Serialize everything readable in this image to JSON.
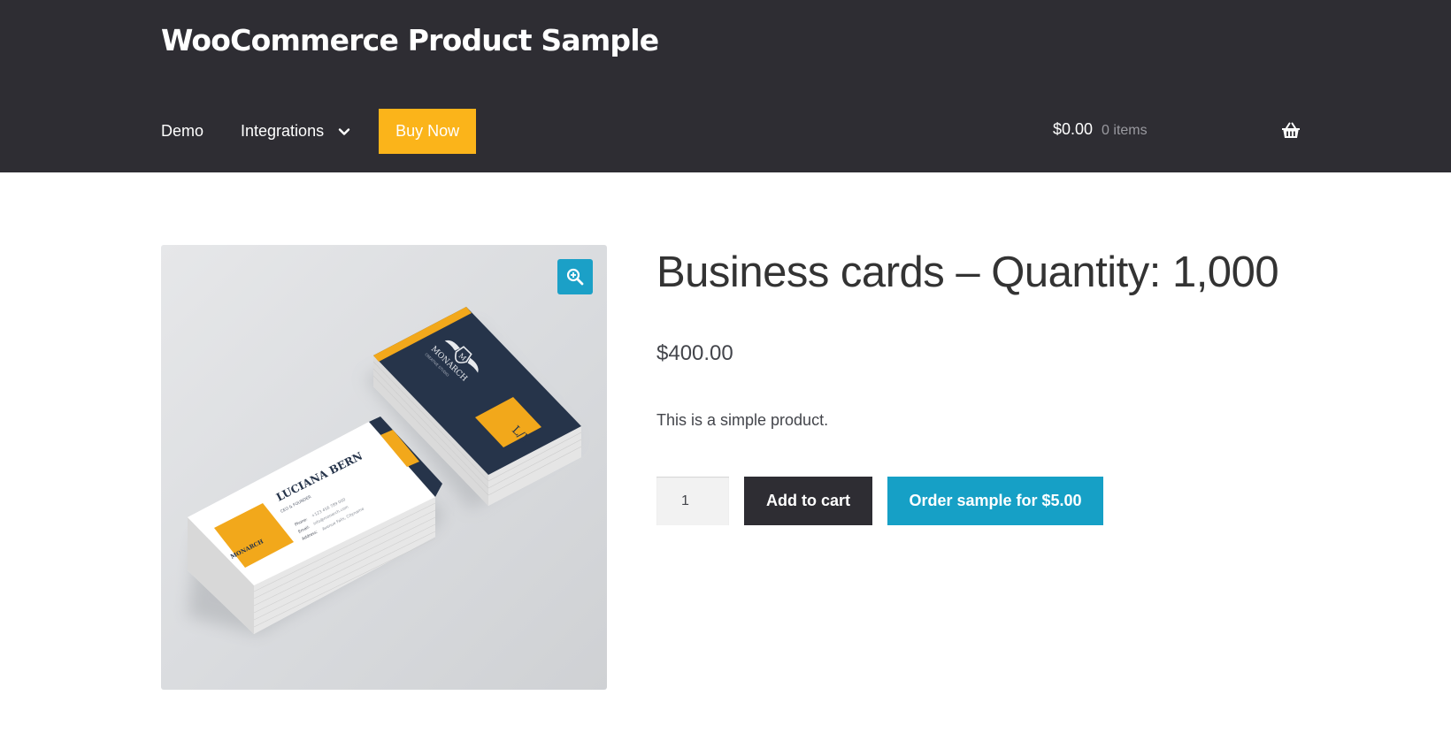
{
  "header": {
    "site_title": "WooCommerce Product Sample",
    "background": "#2e2d33"
  },
  "nav": {
    "items": [
      {
        "label": "Demo"
      },
      {
        "label": "Integrations",
        "has_dropdown": true,
        "icon": "chevron-down-icon"
      },
      {
        "label": "Buy Now",
        "highlight_color": "#fbb41a"
      }
    ]
  },
  "cart": {
    "amount": "$0.00",
    "count": "0 items",
    "icon": "basket-icon"
  },
  "product": {
    "title": "Business cards – Quantity: 1,000",
    "price": "$400.00",
    "short_description": "This is a simple product.",
    "image": {
      "zoom_icon": "zoom-in-icon",
      "card_brand": "MONARCH",
      "card_brand_sub": "CREATIVE STUDIO",
      "card_name": "LUCIANA BERN",
      "card_role": "CEO & FOUNDER",
      "card_monogram": "L/B",
      "card_contact_labels": [
        "Phone:",
        "Email:",
        "Address:"
      ],
      "card_contact_values": [
        "+123 456 789 000",
        "info@monarch.com",
        "Avenue Falls, Cityname"
      ],
      "accent": "#f2a81b",
      "card_dark": "#26344a"
    }
  },
  "form": {
    "quantity": "1",
    "add_to_cart_label": "Add to cart",
    "order_sample_label": "Order sample for $5.00",
    "order_sample_color": "#16a0c6"
  }
}
